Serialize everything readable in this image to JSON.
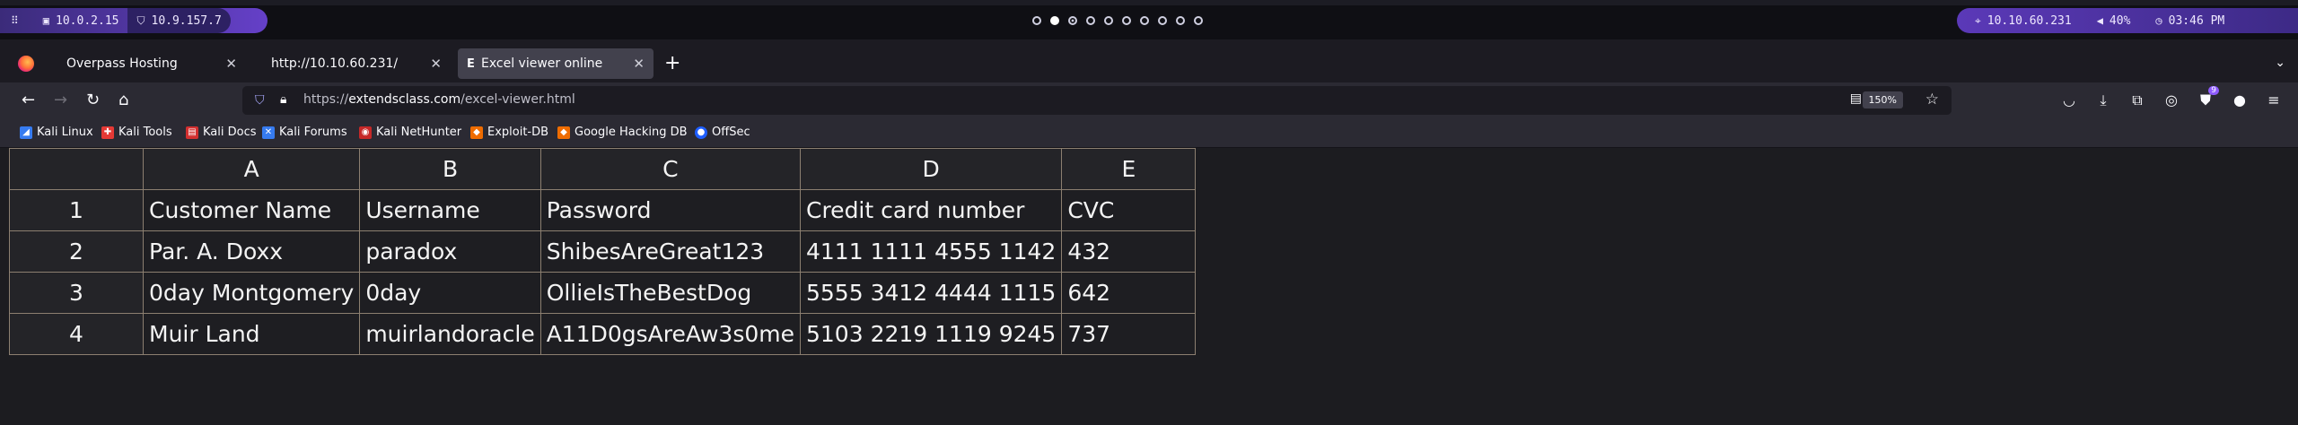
{
  "panel": {
    "ip_local": "10.0.2.15",
    "ip_vpn": "10.9.157.7",
    "target_ip": "10.10.60.231",
    "volume": "40%",
    "clock": "03:46 PM"
  },
  "tabs": [
    {
      "label": "Overpass Hosting",
      "active": false
    },
    {
      "label": "http://10.10.60.231/",
      "active": false
    },
    {
      "label": "Excel viewer online",
      "active": true,
      "favicon": "E"
    }
  ],
  "navbar": {
    "url_prefix": "https://",
    "url_domain": "extendsclass.com",
    "url_path": "/excel-viewer.html",
    "zoom": "150%",
    "extension_badge_count": "9"
  },
  "bookmarks": [
    {
      "label": "Kali Linux",
      "icon": "kali-icon",
      "color": "#367bf0"
    },
    {
      "label": "Kali Tools",
      "icon": "kali-tools-icon",
      "color": "#e53935"
    },
    {
      "label": "Kali Docs",
      "icon": "kali-docs-icon",
      "color": "#d32f2f"
    },
    {
      "label": "Kali Forums",
      "icon": "kali-forums-icon",
      "color": "#367bf0"
    },
    {
      "label": "Kali NetHunter",
      "icon": "nethunter-icon",
      "color": "#c62828"
    },
    {
      "label": "Exploit-DB",
      "icon": "exploitdb-icon",
      "color": "#ef6c00"
    },
    {
      "label": "Google Hacking DB",
      "icon": "ghdb-icon",
      "color": "#ef6c00"
    },
    {
      "label": "OffSec",
      "icon": "offsec-icon",
      "color": "#1e5eff"
    }
  ],
  "sheet": {
    "columns": [
      "",
      "A",
      "B",
      "C",
      "D",
      "E"
    ],
    "rows": [
      {
        "n": "1",
        "cells": [
          "Customer Name",
          "Username",
          "Password",
          "Credit card number",
          "CVC"
        ]
      },
      {
        "n": "2",
        "cells": [
          "Par. A. Doxx",
          "paradox",
          "ShibesAreGreat123",
          "4111 1111 4555 1142",
          "432"
        ]
      },
      {
        "n": "3",
        "cells": [
          "0day Montgomery",
          "0day",
          "OllieIsTheBestDog",
          "5555 3412 4444 1115",
          "642"
        ]
      },
      {
        "n": "4",
        "cells": [
          "Muir Land",
          "muirlandoracle",
          "A11D0gsAreAw3s0me",
          "5103 2219 1119 9245",
          "737"
        ]
      }
    ]
  }
}
